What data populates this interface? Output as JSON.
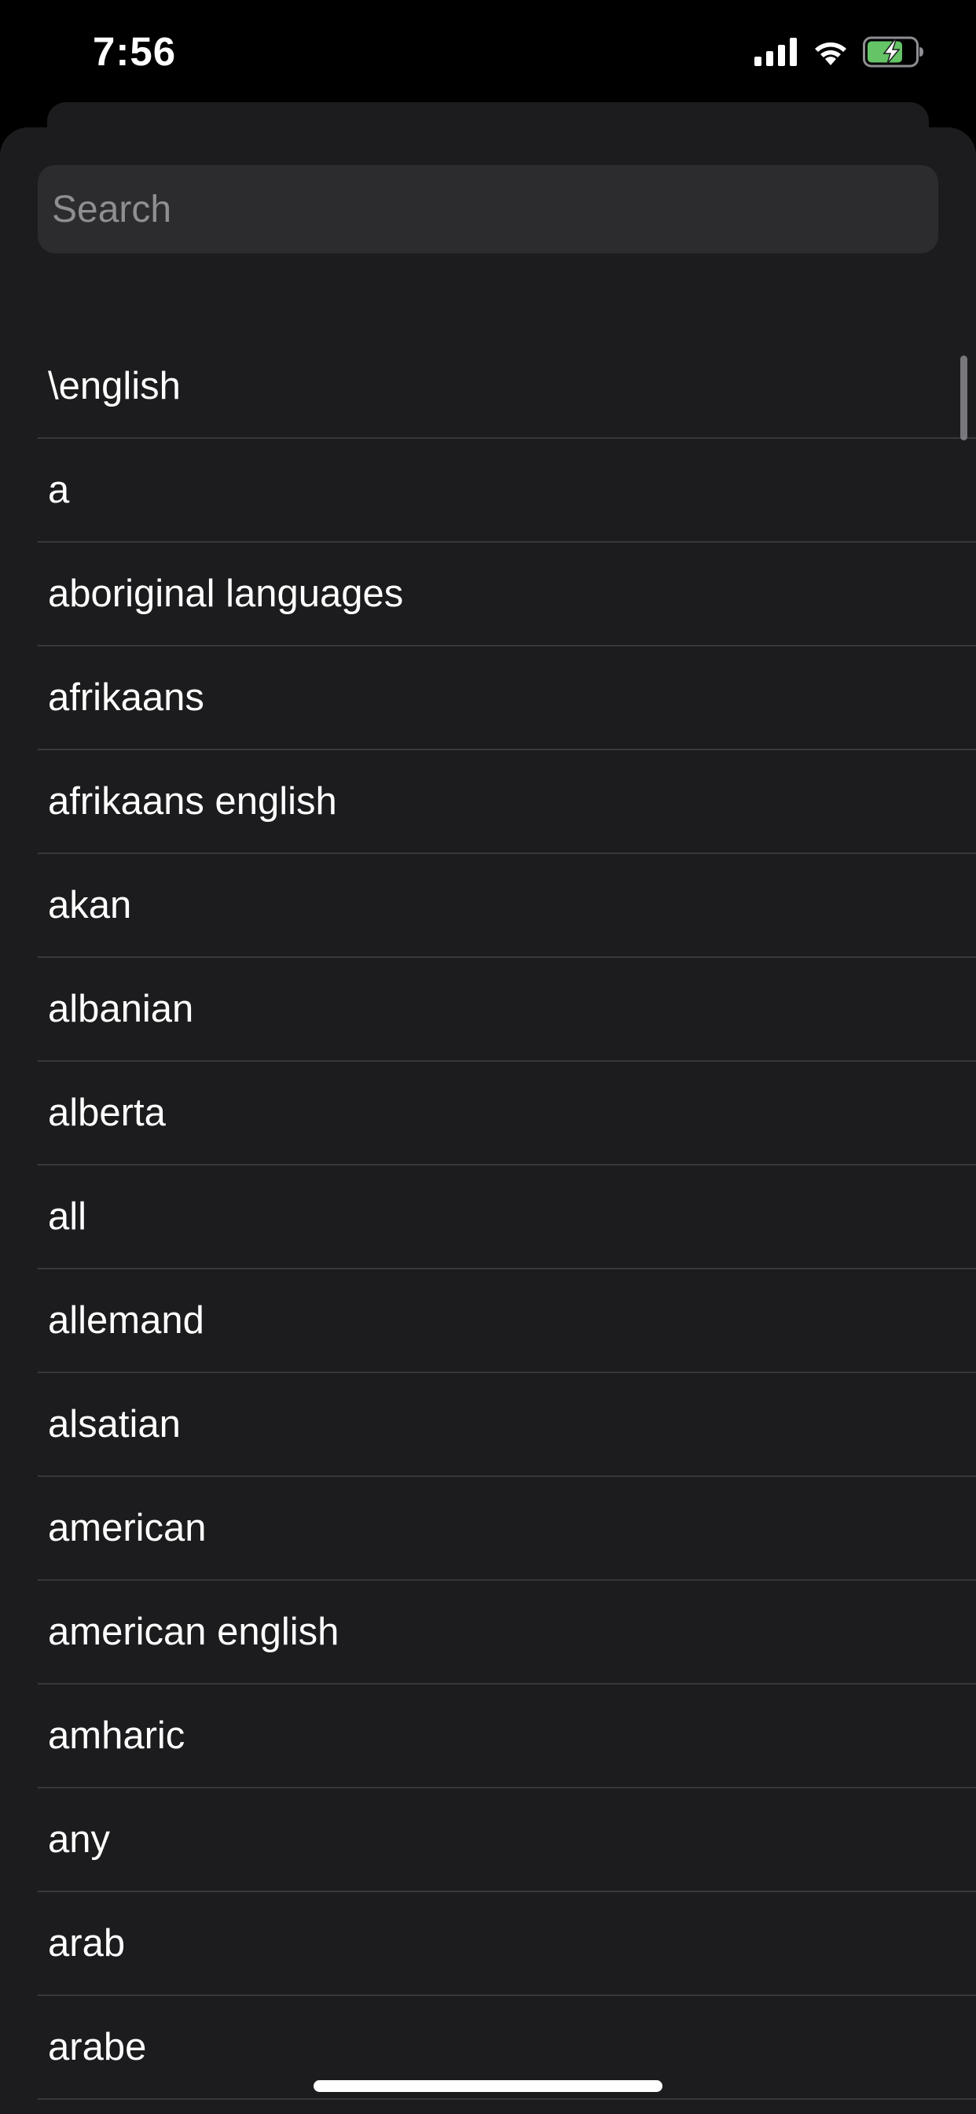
{
  "status_bar": {
    "time": "7:56",
    "icons": [
      "cellular-signal-icon",
      "wifi-icon",
      "battery-charging-icon"
    ],
    "battery_color": "#65c466"
  },
  "search": {
    "placeholder": "Search",
    "value": ""
  },
  "list": {
    "items": [
      "\\english",
      "a",
      "aboriginal languages",
      "afrikaans",
      "afrikaans english",
      "akan",
      "albanian",
      "alberta",
      "all",
      "allemand",
      "alsatian",
      "american",
      "american english",
      "amharic",
      "any",
      "arab",
      "arabe"
    ]
  },
  "colors": {
    "background": "#000000",
    "sheet": "#1c1c1e",
    "search_field": "#2c2c2e",
    "separator": "#38383a",
    "placeholder": "#8e8e93"
  }
}
